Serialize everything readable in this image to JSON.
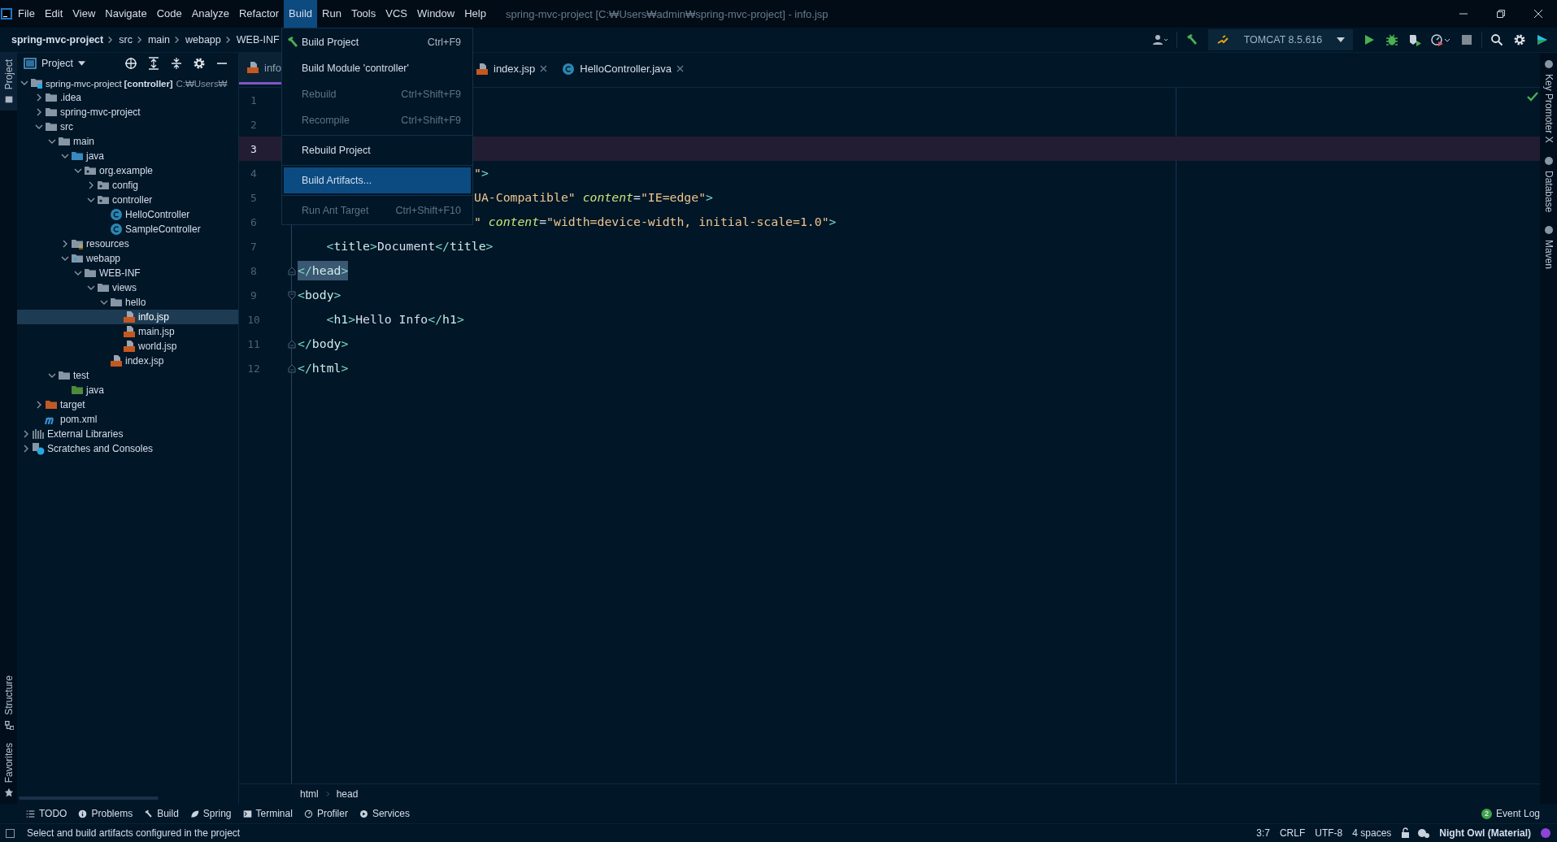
{
  "window": {
    "title": "spring-mvc-project [C:₩Users₩admin₩spring-mvc-project] - info.jsp"
  },
  "menu_bar": [
    {
      "label": "File",
      "selected": false
    },
    {
      "label": "Edit",
      "selected": false
    },
    {
      "label": "View",
      "selected": false
    },
    {
      "label": "Navigate",
      "selected": false
    },
    {
      "label": "Code",
      "selected": false
    },
    {
      "label": "Analyze",
      "selected": false
    },
    {
      "label": "Refactor",
      "selected": false
    },
    {
      "label": "Build",
      "selected": true
    },
    {
      "label": "Run",
      "selected": false
    },
    {
      "label": "Tools",
      "selected": false
    },
    {
      "label": "VCS",
      "selected": false
    },
    {
      "label": "Window",
      "selected": false
    },
    {
      "label": "Help",
      "selected": false
    }
  ],
  "breadcrumb": [
    {
      "label": "spring-mvc-project",
      "kind": "project"
    },
    {
      "label": "src",
      "kind": "folder"
    },
    {
      "label": "main",
      "kind": "folder"
    },
    {
      "label": "webapp",
      "kind": "folder"
    },
    {
      "label": "WEB-INF",
      "kind": "folder"
    }
  ],
  "run_configuration": {
    "label": "TOMCAT 8.5.616"
  },
  "tool_strips": {
    "left_top": [
      {
        "label": "Project",
        "selected": true
      }
    ],
    "left_bottom": [
      {
        "label": "Structure",
        "selected": false
      },
      {
        "label": "Favorites",
        "selected": false
      }
    ],
    "right": [
      {
        "label": "Key Promoter X",
        "selected": false
      },
      {
        "label": "Database",
        "selected": false
      },
      {
        "label": "Maven",
        "selected": false
      }
    ]
  },
  "project_panel": {
    "title": "Project",
    "tree": [
      {
        "name": "spring-mvc-project",
        "module": "[controller]",
        "path": "C:₩Users₩",
        "kind": "module",
        "expanded": true,
        "selected": false,
        "children": [
          {
            "name": ".idea",
            "kind": "folder",
            "expanded": false,
            "selected": false
          },
          {
            "name": "spring-mvc-project",
            "kind": "folder",
            "expanded": false,
            "selected": false
          },
          {
            "name": "src",
            "kind": "folder",
            "expanded": true,
            "selected": false,
            "children": [
              {
                "name": "main",
                "kind": "folder",
                "expanded": true,
                "selected": false,
                "children": [
                  {
                    "name": "java",
                    "kind": "source",
                    "expanded": true,
                    "selected": false,
                    "children": [
                      {
                        "name": "org.example",
                        "kind": "package",
                        "expanded": true,
                        "selected": false,
                        "children": [
                          {
                            "name": "config",
                            "kind": "package",
                            "expanded": false,
                            "selected": false
                          },
                          {
                            "name": "controller",
                            "kind": "package",
                            "expanded": true,
                            "selected": false,
                            "children": [
                              {
                                "name": "HelloController",
                                "kind": "class",
                                "selected": false
                              },
                              {
                                "name": "SampleController",
                                "kind": "class",
                                "selected": false
                              }
                            ]
                          }
                        ]
                      }
                    ]
                  },
                  {
                    "name": "resources",
                    "kind": "resources",
                    "expanded": false,
                    "selected": false
                  },
                  {
                    "name": "webapp",
                    "kind": "web",
                    "expanded": true,
                    "selected": false,
                    "children": [
                      {
                        "name": "WEB-INF",
                        "kind": "folder",
                        "expanded": true,
                        "selected": false,
                        "children": [
                          {
                            "name": "views",
                            "kind": "folder",
                            "expanded": true,
                            "selected": false,
                            "children": [
                              {
                                "name": "hello",
                                "kind": "folder",
                                "expanded": true,
                                "selected": false,
                                "children": [
                                  {
                                    "name": "info.jsp",
                                    "kind": "jsp",
                                    "selected": true
                                  },
                                  {
                                    "name": "main.jsp",
                                    "kind": "jsp",
                                    "selected": false
                                  },
                                  {
                                    "name": "world.jsp",
                                    "kind": "jsp",
                                    "selected": false
                                  }
                                ]
                              },
                              {
                                "name": "index.jsp",
                                "kind": "jsp",
                                "selected": false
                              }
                            ]
                          }
                        ]
                      }
                    ]
                  }
                ]
              },
              {
                "name": "test",
                "kind": "folder",
                "expanded": true,
                "selected": false,
                "children": [
                  {
                    "name": "java",
                    "kind": "test-source",
                    "selected": false
                  }
                ]
              }
            ]
          },
          {
            "name": "target",
            "kind": "excluded",
            "expanded": false,
            "selected": false
          },
          {
            "name": "pom.xml",
            "kind": "maven",
            "selected": false
          }
        ]
      },
      {
        "name": "External Libraries",
        "kind": "libraries",
        "expanded": false,
        "selected": false
      },
      {
        "name": "Scratches and Consoles",
        "kind": "scratches",
        "expanded": false,
        "selected": false
      }
    ]
  },
  "editor": {
    "tabs": [
      {
        "label": "info",
        "kind": "jsp",
        "selected": true,
        "closable": false
      },
      {
        "label": "index.jsp",
        "kind": "jsp",
        "selected": false,
        "closable": true
      },
      {
        "label": "HelloController.java",
        "kind": "class",
        "selected": false,
        "closable": true
      }
    ],
    "lines": [
      {
        "number": "1",
        "kind": "plain",
        "current": false
      },
      {
        "number": "2",
        "kind": "plain",
        "current": false
      },
      {
        "number": "3",
        "kind": "plain",
        "current": true
      },
      {
        "number": "4",
        "kind": "plain",
        "current": false,
        "highlighted": false,
        "covered": true,
        "indented": false,
        "tokens": [
          {
            "kind": "string",
            "text": "\""
          },
          {
            "kind": "punct",
            "text": ">"
          }
        ]
      },
      {
        "number": "5",
        "kind": "plain",
        "current": false,
        "highlighted": false,
        "covered": true,
        "indented": false,
        "tokens": [
          {
            "kind": "string",
            "text": "UA-Compatible\" "
          },
          {
            "kind": "attr",
            "text": "content"
          },
          {
            "kind": "text",
            "text": "="
          },
          {
            "kind": "string",
            "text": "\"IE=edge\""
          },
          {
            "kind": "punct",
            "text": ">"
          }
        ]
      },
      {
        "number": "6",
        "kind": "plain",
        "current": false,
        "highlighted": false,
        "covered": true,
        "indented": false,
        "tokens": [
          {
            "kind": "string",
            "text": "\" "
          },
          {
            "kind": "attr",
            "text": "content"
          },
          {
            "kind": "text",
            "text": "="
          },
          {
            "kind": "string",
            "text": "\"width=device-width, initial-scale=1.0\""
          },
          {
            "kind": "punct",
            "text": ">"
          }
        ]
      },
      {
        "number": "7",
        "kind": "plain",
        "current": false,
        "highlighted": false,
        "indented": true,
        "tokens": [
          {
            "kind": "punct",
            "text": "<"
          },
          {
            "kind": "tag",
            "text": "title"
          },
          {
            "kind": "punct",
            "text": ">"
          },
          {
            "kind": "text",
            "text": "Document"
          },
          {
            "kind": "punct",
            "text": "</"
          },
          {
            "kind": "tag",
            "text": "title"
          },
          {
            "kind": "punct",
            "text": ">"
          }
        ]
      },
      {
        "number": "8",
        "kind": "fold-end",
        "current": false,
        "highlighted": true,
        "indented": false,
        "tokens": [
          {
            "kind": "punct",
            "text": "</"
          },
          {
            "kind": "tag",
            "text": "head"
          },
          {
            "kind": "punct",
            "text": ">"
          }
        ]
      },
      {
        "number": "9",
        "kind": "fold-start",
        "current": false,
        "highlighted": false,
        "indented": false,
        "tokens": [
          {
            "kind": "punct",
            "text": "<"
          },
          {
            "kind": "tag",
            "text": "body"
          },
          {
            "kind": "punct",
            "text": ">"
          }
        ]
      },
      {
        "number": "10",
        "kind": "plain",
        "current": false,
        "highlighted": false,
        "indented": true,
        "tokens": [
          {
            "kind": "punct",
            "text": "<"
          },
          {
            "kind": "tag",
            "text": "h1"
          },
          {
            "kind": "punct",
            "text": ">"
          },
          {
            "kind": "text",
            "text": "Hello Info"
          },
          {
            "kind": "punct",
            "text": "</"
          },
          {
            "kind": "tag",
            "text": "h1"
          },
          {
            "kind": "punct",
            "text": ">"
          }
        ]
      },
      {
        "number": "11",
        "kind": "fold-end",
        "current": false,
        "highlighted": false,
        "indented": false,
        "tokens": [
          {
            "kind": "punct",
            "text": "</"
          },
          {
            "kind": "tag",
            "text": "body"
          },
          {
            "kind": "punct",
            "text": ">"
          }
        ]
      },
      {
        "number": "12",
        "kind": "fold-end",
        "current": false,
        "highlighted": false,
        "indented": false,
        "tokens": [
          {
            "kind": "punct",
            "text": "</"
          },
          {
            "kind": "tag",
            "text": "html"
          },
          {
            "kind": "punct",
            "text": ">"
          }
        ]
      }
    ],
    "breadcrumb": [
      "html",
      "head"
    ]
  },
  "build_menu": {
    "groups": [
      [
        {
          "label": "Build Project",
          "shortcut": "Ctrl+F9",
          "kind": "hammer",
          "disabled": false,
          "selected": false
        },
        {
          "label": "Build Module 'controller'",
          "kind": "plain",
          "disabled": false,
          "selected": false
        },
        {
          "label": "Rebuild",
          "shortcut": "Ctrl+Shift+F9",
          "kind": "plain",
          "disabled": true,
          "selected": false
        },
        {
          "label": "Recompile",
          "shortcut": "Ctrl+Shift+F9",
          "kind": "plain",
          "disabled": true,
          "selected": false
        }
      ],
      [
        {
          "label": "Rebuild Project",
          "kind": "plain",
          "disabled": false,
          "selected": false
        }
      ],
      [
        {
          "label": "Build Artifacts...",
          "kind": "plain",
          "disabled": false,
          "selected": true
        }
      ],
      [
        {
          "label": "Run Ant Target",
          "shortcut": "Ctrl+Shift+F10",
          "kind": "plain",
          "disabled": true,
          "selected": false
        }
      ]
    ]
  },
  "tool_windows": [
    {
      "label": "TODO",
      "kind": "list"
    },
    {
      "label": "Problems",
      "kind": "info"
    },
    {
      "label": "Build",
      "kind": "hammer"
    },
    {
      "label": "Spring",
      "kind": "leaf"
    },
    {
      "label": "Terminal",
      "kind": "terminal"
    },
    {
      "label": "Profiler",
      "kind": "gauge"
    },
    {
      "label": "Services",
      "kind": "services"
    }
  ],
  "event_log": {
    "label": "Event Log",
    "count": "2"
  },
  "status_bar": {
    "message": "Select and build artifacts configured in the project",
    "items": [
      "3:7",
      "CRLF",
      "UTF-8",
      "4 spaces"
    ],
    "theme": "Night Owl (Material)"
  }
}
